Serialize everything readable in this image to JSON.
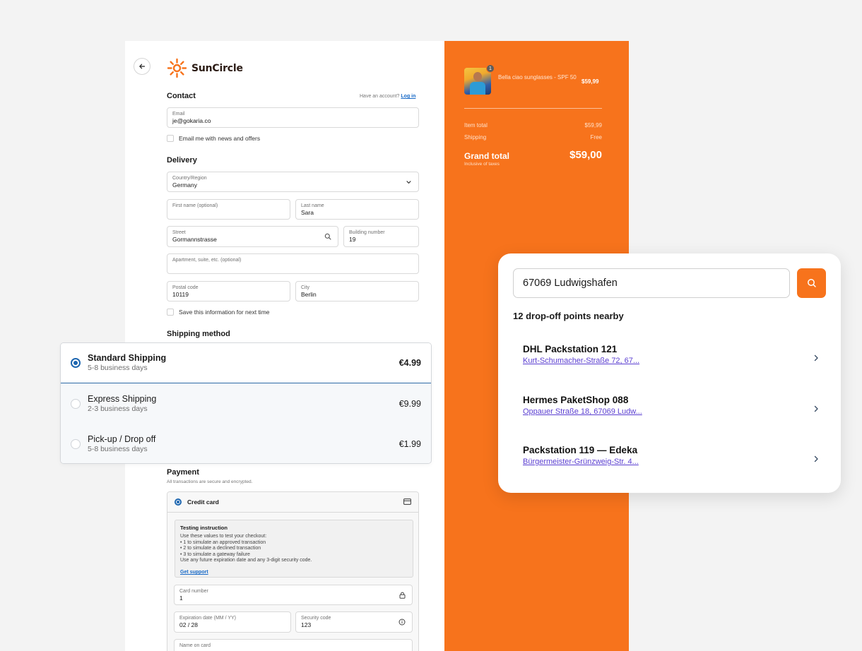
{
  "brand": {
    "name": "SunCircle"
  },
  "contact": {
    "title": "Contact",
    "have_account": "Have an account?",
    "login": "Log in",
    "email_label": "Email",
    "email_value": "je@gokaria.co",
    "newsletter": "Email me with news and offers"
  },
  "delivery": {
    "title": "Delivery",
    "country_label": "Country/Region",
    "country_value": "Germany",
    "first_name_label": "First name (optional)",
    "last_name_label": "Last name",
    "last_name_value": "Sara",
    "street_label": "Street",
    "street_value": "Gormannstrasse",
    "building_label": "Building number",
    "building_value": "19",
    "apartment_label": "Apartment, suite, etc. (optional)",
    "postal_label": "Postal code",
    "postal_value": "10119",
    "city_label": "City",
    "city_value": "Berlin",
    "save_info": "Save this information for next time"
  },
  "shipping": {
    "title": "Shipping method",
    "options": [
      {
        "name": "Standard Shipping",
        "sub": "5-8 business days",
        "price": "€4.99",
        "selected": true
      },
      {
        "name": "Express Shipping",
        "sub": "2-3 business days",
        "price": "€9.99",
        "selected": false
      },
      {
        "name": "Pick-up / Drop off",
        "sub": "5-8 business days",
        "price": "€1.99",
        "selected": false
      }
    ]
  },
  "payment": {
    "title": "Payment",
    "subtitle": "All transactions are secure and encrypted.",
    "method": "Credit card",
    "test_title": "Testing instruction",
    "test_lines": [
      "Use these values to test your checkout:",
      "• 1 to simulate an approved transaction",
      "• 2 to simulate a declined transaction",
      "• 3 to simulate a gateway failure",
      "Use any future expiration date and any 3-digit security code."
    ],
    "support_link": "Get support",
    "card_label": "Card number",
    "card_value": "1",
    "exp_label": "Expiration date (MM / YY)",
    "exp_value": "02 / 28",
    "cvc_label": "Security code",
    "cvc_value": "123",
    "name_label": "Name on card"
  },
  "summary": {
    "quantity_badge": "1",
    "product_name": "Bella ciao sunglasses - SPF 50",
    "product_price": "$59,99",
    "item_total_label": "Item total",
    "item_total_value": "$59,99",
    "shipping_label": "Shipping",
    "shipping_value": "Free",
    "grand_total_label": "Grand total",
    "grand_total_sub": "Inclusive of taxes",
    "grand_total_value": "$59,00"
  },
  "dropoff": {
    "search_value": "67069 Ludwigshafen",
    "count_text": "12 drop-off points nearby",
    "points": [
      {
        "name": "DHL Packstation 121",
        "address": "Kurt-Schumacher-Straße 72, 67..."
      },
      {
        "name": "Hermes PaketShop 088",
        "address": "Oppauer Straße 18, 67069 Ludw..."
      },
      {
        "name": "Packstation 119 — Edeka",
        "address": "Bürgermeister-Grünzweig-Str. 4..."
      }
    ]
  },
  "colors": {
    "brand_orange": "#f7731c",
    "radio_blue": "#1d66b0",
    "link_purple": "#5b3fd1"
  }
}
